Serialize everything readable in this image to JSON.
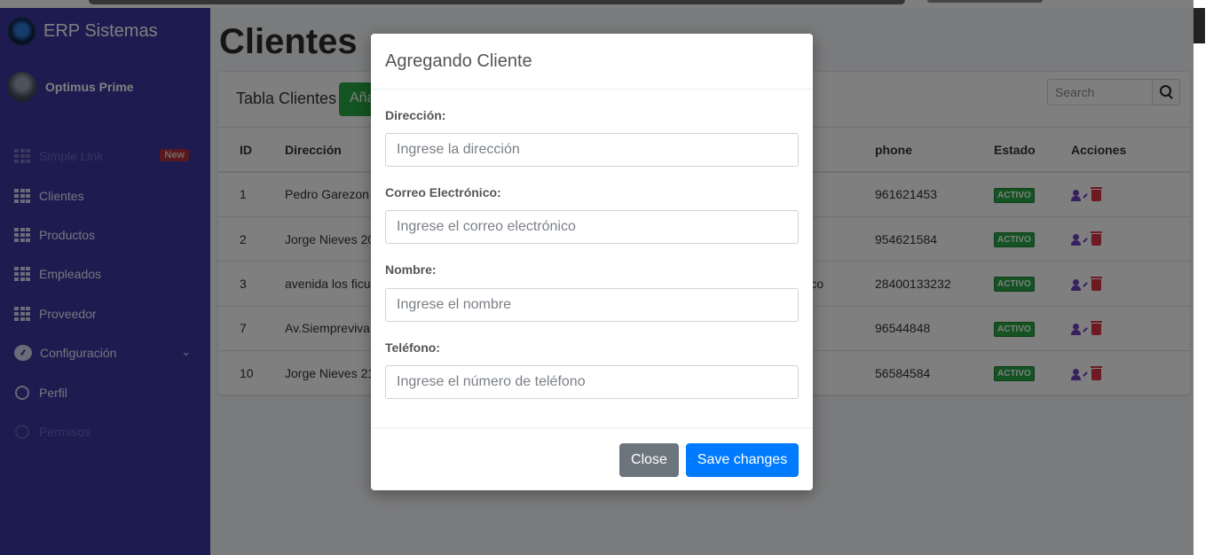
{
  "brand": {
    "title": "ERP Sistemas"
  },
  "user": {
    "name": "Optimus Prime"
  },
  "sidebar": {
    "items": [
      {
        "label": "Simple Link",
        "badge": "New",
        "icon": "grid-icon"
      },
      {
        "label": "Clientes",
        "icon": "grid-icon"
      },
      {
        "label": "Productos",
        "icon": "grid-icon"
      },
      {
        "label": "Empleados",
        "icon": "grid-icon"
      },
      {
        "label": "Proveedor",
        "icon": "grid-icon"
      },
      {
        "label": "Configuración",
        "icon": "gauge-icon"
      },
      {
        "label": "Perfil",
        "icon": "circle-icon"
      },
      {
        "label": "Permisos",
        "icon": "circle-icon"
      }
    ]
  },
  "page": {
    "title": "Clientes"
  },
  "card": {
    "title": "Tabla Clientes",
    "add_button": "Añadir",
    "search_placeholder": "Search"
  },
  "table": {
    "headers": {
      "id": "ID",
      "direccion": "Dirección",
      "phone": "phone",
      "estado": "Estado",
      "acciones": "Acciones"
    },
    "rows": [
      {
        "id": "1",
        "direccion": "Pedro Garezon",
        "extra": "",
        "phone": "961621453",
        "estado": "ACTIVO"
      },
      {
        "id": "2",
        "direccion": "Jorge Nieves 20",
        "extra": "",
        "phone": "954621584",
        "estado": "ACTIVO"
      },
      {
        "id": "3",
        "direccion": "avenida los ficu",
        "extra": "rrico",
        "phone": "28400133232",
        "estado": "ACTIVO"
      },
      {
        "id": "7",
        "direccion": "Av.Siempreviva",
        "extra": "",
        "phone": "96544848",
        "estado": "ACTIVO"
      },
      {
        "id": "10",
        "direccion": "Jorge Nieves 21",
        "extra": "",
        "phone": "56584584",
        "estado": "ACTIVO"
      }
    ]
  },
  "modal": {
    "title": "Agregando Cliente",
    "fields": [
      {
        "label": "Dirección:",
        "placeholder": "Ingrese la dirección"
      },
      {
        "label": "Correo Electrónico:",
        "placeholder": "Ingrese el correo electrónico"
      },
      {
        "label": "Nombre:",
        "placeholder": "Ingrese el nombre"
      },
      {
        "label": "Teléfono:",
        "placeholder": "Ingrese el número de teléfono"
      }
    ],
    "close_label": "Close",
    "save_label": "Save changes"
  },
  "colors": {
    "sidebar": "#3c37a0",
    "success": "#28a745",
    "primary": "#007bff",
    "secondary": "#6c757d",
    "danger": "#dc3545"
  }
}
